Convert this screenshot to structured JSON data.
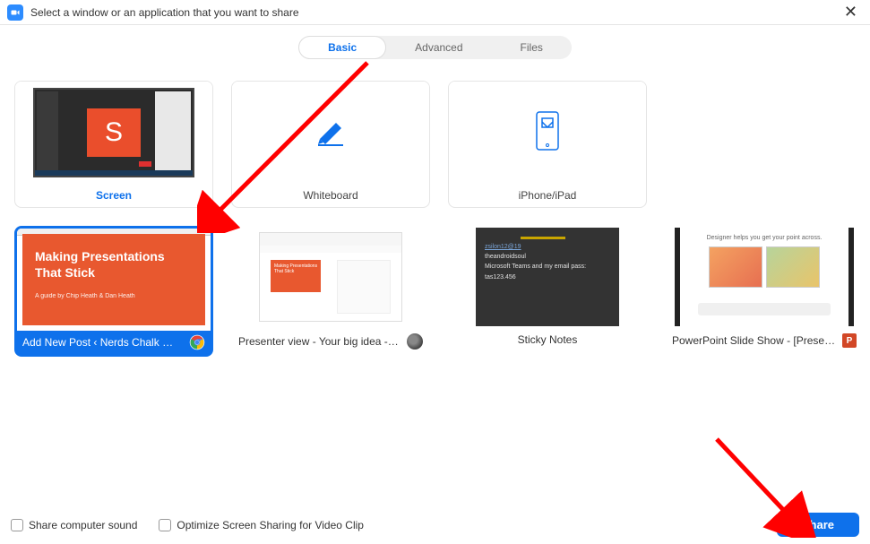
{
  "titlebar": {
    "text": "Select a window or an application that you want to share"
  },
  "tabs": {
    "basic": "Basic",
    "advanced": "Advanced",
    "files": "Files"
  },
  "row1": {
    "screen": {
      "label": "Screen",
      "letter": "S"
    },
    "whiteboard": {
      "label": "Whiteboard"
    },
    "iphone": {
      "label": "iPhone/iPad"
    }
  },
  "row2": {
    "chrome": {
      "label": "Add New Post ‹ Nerds Chalk — ...",
      "slide_title": "Making Presentations That Stick",
      "slide_sub": "A guide by Chip Heath & Dan Heath"
    },
    "presenter": {
      "label": "Presenter view - Your big idea - G...",
      "mini_title": "Making Presentations That Stick"
    },
    "sticky": {
      "label": "Sticky Notes",
      "line1": "zsilon12@19",
      "line2": "theandroidsoul",
      "line3": "Microsoft Teams and my email pass:",
      "line4": "tas123.456"
    },
    "powerpoint": {
      "label": "PowerPoint Slide Show - [Present...",
      "caption": "Designer helps you get your point across.",
      "badge": "P"
    }
  },
  "footer": {
    "share_sound": "Share computer sound",
    "optimize": "Optimize Screen Sharing for Video Clip",
    "share_btn": "Share"
  }
}
